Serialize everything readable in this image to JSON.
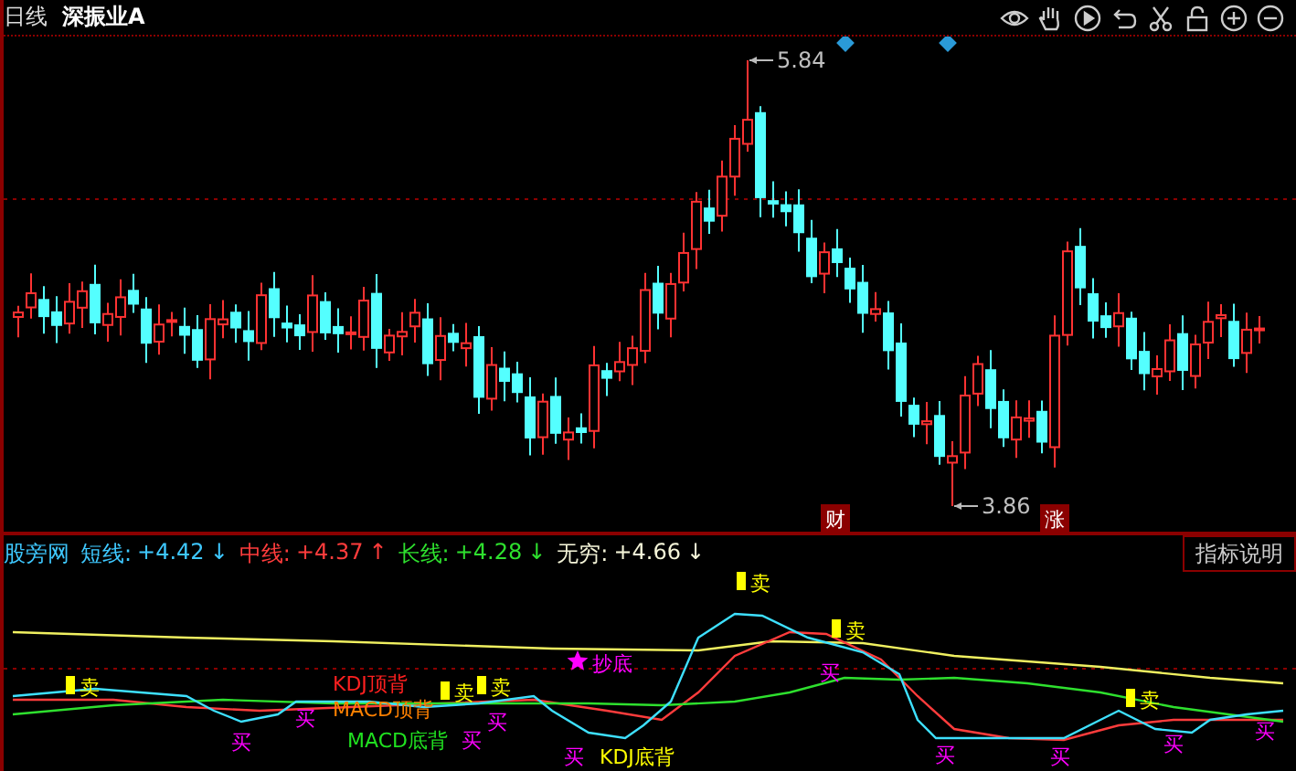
{
  "header": {
    "period": "日线",
    "stock_name": "深振业A"
  },
  "price_chart": {
    "high_label": "5.84",
    "low_label": "3.86",
    "event_tags": [
      {
        "text": "财"
      },
      {
        "text": "涨"
      }
    ]
  },
  "indicator": {
    "name": "股旁网",
    "legend": [
      {
        "label": "短线:",
        "value": "+4.42",
        "arrow": "↓",
        "color": "#3ec8ff"
      },
      {
        "label": "中线:",
        "value": "+4.37",
        "arrow": "↑",
        "color": "#ff3c3c"
      },
      {
        "label": "长线:",
        "value": "+4.28",
        "arrow": "↓",
        "color": "#2ee02e"
      },
      {
        "label": "无穷:",
        "value": "+4.66",
        "arrow": "↓",
        "color": "#f4f4d8"
      }
    ],
    "help_button": "指标说明",
    "signals": [
      {
        "kind": "sell",
        "text": "卖",
        "color": "#ffff00"
      },
      {
        "kind": "buy",
        "text": "买",
        "color": "#ff00ff"
      },
      {
        "kind": "buy",
        "text": "买",
        "color": "#ff00ff"
      },
      {
        "kind": "note",
        "text": "KDJ顶背",
        "color": "#ff2020"
      },
      {
        "kind": "note",
        "text": "MACD顶背",
        "color": "#ff8000"
      },
      {
        "kind": "sell",
        "text": "卖",
        "color": "#ffff00"
      },
      {
        "kind": "note",
        "text": "MACD底背",
        "color": "#20e020"
      },
      {
        "kind": "buy",
        "text": "买",
        "color": "#ff00ff"
      },
      {
        "kind": "buy",
        "text": "买",
        "color": "#ff00ff"
      },
      {
        "kind": "sell",
        "text": "卖",
        "color": "#ffff00"
      },
      {
        "kind": "star",
        "text": "抄底",
        "color": "#ff00ff"
      },
      {
        "kind": "buy",
        "text": "买",
        "color": "#ff00ff"
      },
      {
        "kind": "note",
        "text": "KDJ底背",
        "color": "#ffff00"
      },
      {
        "kind": "sell",
        "text": "卖",
        "color": "#ffff00"
      },
      {
        "kind": "sell",
        "text": "卖",
        "color": "#ffff00"
      },
      {
        "kind": "buy",
        "text": "买",
        "color": "#ff00ff"
      },
      {
        "kind": "buy",
        "text": "买",
        "color": "#ff00ff"
      },
      {
        "kind": "buy",
        "text": "买",
        "color": "#ff00ff"
      },
      {
        "kind": "sell",
        "text": "卖",
        "color": "#ffff00"
      },
      {
        "kind": "buy",
        "text": "买",
        "color": "#ff00ff"
      },
      {
        "kind": "buy",
        "text": "买",
        "color": "#ff00ff"
      }
    ]
  }
}
